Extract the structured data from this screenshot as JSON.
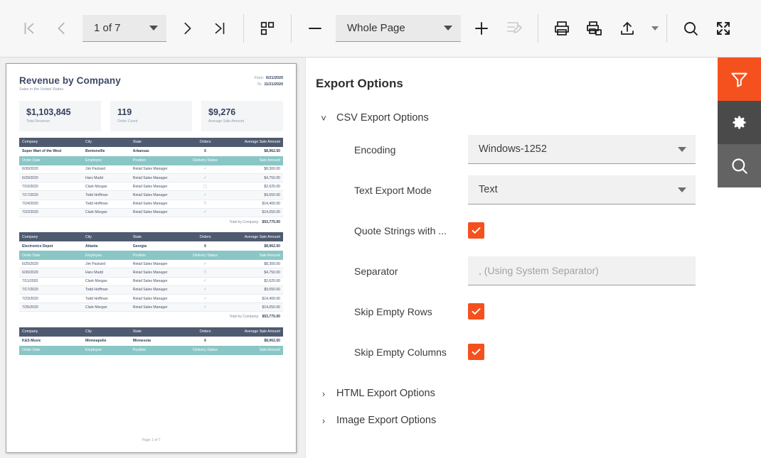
{
  "toolbar": {
    "first_page": "first-page",
    "prev_page": "previous-page",
    "page_value": "1 of 7",
    "next_page": "next-page",
    "last_page": "last-page",
    "thumbnails": "page-thumbnails",
    "zoom_out": "zoom-out",
    "zoom_value": "Whole Page",
    "zoom_in": "zoom-in",
    "edit": "edit-document",
    "print": "print",
    "print_multiple": "print-multiple",
    "export": "export",
    "export_menu": "export-menu",
    "search": "search",
    "fullscreen": "fullscreen"
  },
  "panel": {
    "title": "Export Options",
    "groups": [
      {
        "label": "CSV Export Options",
        "expanded": true
      },
      {
        "label": "HTML Export Options",
        "expanded": false
      },
      {
        "label": "Image Export Options",
        "expanded": false
      }
    ],
    "csv": {
      "encoding": {
        "label": "Encoding",
        "value": "Windows-1252"
      },
      "text_export_mode": {
        "label": "Text Export Mode",
        "value": "Text"
      },
      "quote_strings": {
        "label": "Quote Strings with ...",
        "checked": true
      },
      "separator": {
        "label": "Separator",
        "value": "",
        "placeholder": ", (Using System Separator)"
      },
      "skip_empty_rows": {
        "label": "Skip Empty Rows",
        "checked": true
      },
      "skip_empty_columns": {
        "label": "Skip Empty Columns",
        "checked": true
      }
    }
  },
  "rail": {
    "filter": "filter",
    "settings": "settings",
    "search": "search"
  },
  "report": {
    "title": "Revenue by Company",
    "subtitle": "Sales in the United States",
    "from_label": "From:",
    "from_value": "6/21/2020",
    "to_label": "To:",
    "to_value": "11/21/2020",
    "kpis": [
      {
        "value": "$1,103,845",
        "label": "Total Revenue"
      },
      {
        "value": "119",
        "label": "Order Count"
      },
      {
        "value": "$9,276",
        "label": "Average Sale Amount"
      }
    ],
    "company_headers": [
      "Company",
      "City",
      "State",
      "Orders",
      "Average Sale Amount"
    ],
    "detail_headers": [
      "Order Date",
      "Employee",
      "Position",
      "Delivery Status",
      "Sale Amount"
    ],
    "total_label": "Total by Company:",
    "page_footer": "Page 1 of 7",
    "sections": [
      {
        "company": [
          "Super Mart of the West",
          "Bentonville",
          "Arkansas",
          "6",
          "$8,962.50"
        ],
        "rows": [
          [
            "6/30/2020",
            "Jim Packard",
            "Retail Sales Manager",
            "check",
            "$8,300.00"
          ],
          [
            "6/29/2020",
            "Harv Mudd",
            "Retail Sales Manager",
            "check",
            "$4,750.00"
          ],
          [
            "7/10/2020",
            "Clark Morgan",
            "Retail Sales Manager",
            "truck",
            "$2,625.00"
          ],
          [
            "7/17/2020",
            "Todd Hoffman",
            "Retail Sales Manager",
            "check",
            "$9,650.00"
          ],
          [
            "7/24/2020",
            "Todd Hoffman",
            "Retail Sales Manager",
            "clock",
            "$14,400.00"
          ],
          [
            "7/22/2020",
            "Clark Morgan",
            "Retail Sales Manager",
            "check",
            "$14,050.00"
          ]
        ],
        "total": "$53,775.00"
      },
      {
        "company": [
          "Electronics Depot",
          "Atlanta",
          "Georgia",
          "6",
          "$8,962.50"
        ],
        "rows": [
          [
            "6/25/2020",
            "Jim Packard",
            "Retail Sales Manager",
            "check",
            "$8,300.00"
          ],
          [
            "6/30/2020",
            "Harv Mudd",
            "Retail Sales Manager",
            "clock",
            "$4,750.00"
          ],
          [
            "7/11/2020",
            "Clark Morgan",
            "Retail Sales Manager",
            "check",
            "$2,625.00"
          ],
          [
            "7/17/2020",
            "Todd Hoffman",
            "Retail Sales Manager",
            "check",
            "$9,650.00"
          ],
          [
            "7/23/2020",
            "Todd Hoffman",
            "Retail Sales Manager",
            "check",
            "$14,400.00"
          ],
          [
            "7/25/2020",
            "Clark Morgan",
            "Retail Sales Manager",
            "check",
            "$14,050.00"
          ]
        ],
        "total": "$53,775.00"
      },
      {
        "company": [
          "K&S Music",
          "Minneapolis",
          "Minnesota",
          "6",
          "$8,962.50"
        ],
        "rows": [],
        "total": null
      }
    ]
  },
  "colors": {
    "accent": "#f4511e",
    "header_dark": "#4e5a70",
    "header_teal": "#8ac6c6",
    "rail_dark": "#4a4a4a",
    "rail_mid": "#636363"
  }
}
